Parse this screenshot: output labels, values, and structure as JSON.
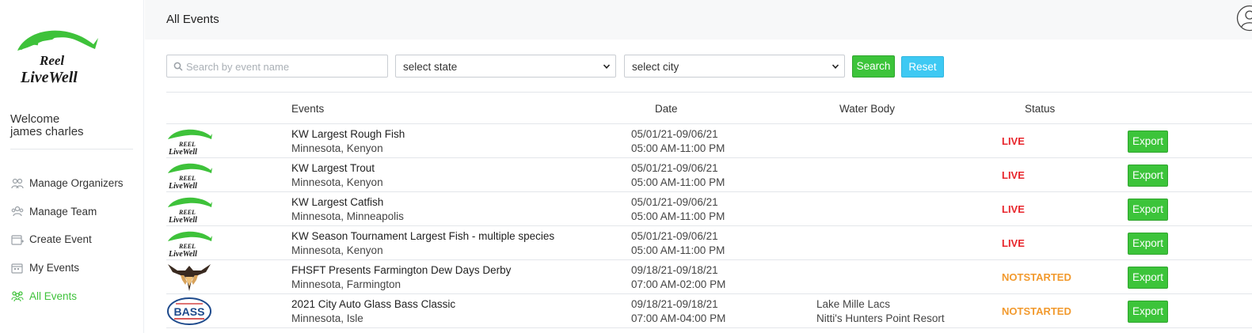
{
  "brand": {
    "logo_line1": "Reel",
    "logo_line2": "LiveWell",
    "color": "#3ec23a"
  },
  "sidebar": {
    "welcome": "Welcome",
    "username": "james charles",
    "items": [
      {
        "label": "Manage Organizers",
        "icon": "organizers-icon",
        "active": false
      },
      {
        "label": "Manage Team",
        "icon": "team-icon",
        "active": false
      },
      {
        "label": "Create Event",
        "icon": "calendar-add-icon",
        "active": false
      },
      {
        "label": "My Events",
        "icon": "calendar-icon",
        "active": false
      },
      {
        "label": "All Events",
        "icon": "group-icon",
        "active": true
      }
    ]
  },
  "header": {
    "title": "All Events",
    "user_icon": "user-avatar-icon"
  },
  "filters": {
    "search_placeholder": "Search by event name",
    "search_value": "",
    "state_select": "select state",
    "city_select": "select city",
    "search_label": "Search",
    "reset_label": "Reset"
  },
  "table": {
    "columns": {
      "events": "Events",
      "date": "Date",
      "water_body": "Water Body",
      "status": "Status"
    },
    "rows": [
      {
        "logo": "reel-livewell-logo",
        "name": "KW Largest Rough Fish",
        "location": "Minnesota, Kenyon",
        "date_range": "05/01/21-09/06/21",
        "time_range": "05:00 AM-11:00 PM",
        "water_body": "",
        "water_body_detail": "",
        "status": "LIVE",
        "export_label": "Export"
      },
      {
        "logo": "reel-livewell-logo",
        "name": "KW Largest Trout",
        "location": "Minnesota, Kenyon",
        "date_range": "05/01/21-09/06/21",
        "time_range": "05:00 AM-11:00 PM",
        "water_body": "",
        "water_body_detail": "",
        "status": "LIVE",
        "export_label": "Export"
      },
      {
        "logo": "reel-livewell-logo",
        "name": "KW Largest Catfish",
        "location": "Minnesota, Minneapolis",
        "date_range": "05/01/21-09/06/21",
        "time_range": "05:00 AM-11:00 PM",
        "water_body": "",
        "water_body_detail": "",
        "status": "LIVE",
        "export_label": "Export"
      },
      {
        "logo": "reel-livewell-logo",
        "name": "KW Season Tournament Largest Fish - multiple species",
        "location": "Minnesota, Kenyon",
        "date_range": "05/01/21-09/06/21",
        "time_range": "05:00 AM-11:00 PM",
        "water_body": "",
        "water_body_detail": "",
        "status": "LIVE",
        "export_label": "Export"
      },
      {
        "logo": "fhsft-antler-logo",
        "name": "FHSFT Presents Farmington Dew Days Derby",
        "location": "Minnesota, Farmington",
        "date_range": "09/18/21-09/18/21",
        "time_range": "07:00 AM-02:00 PM",
        "water_body": "",
        "water_body_detail": "",
        "status": "NOTSTARTED",
        "export_label": "Export"
      },
      {
        "logo": "bass-federation-logo",
        "name": "2021 City Auto Glass Bass Classic",
        "location": "Minnesota, Isle",
        "date_range": "09/18/21-09/18/21",
        "time_range": "07:00 AM-04:00 PM",
        "water_body": "Lake Mille Lacs",
        "water_body_detail": "Nitti's Hunters Point Resort",
        "status": "NOTSTARTED",
        "export_label": "Export",
        "logo_text": "BASS"
      }
    ]
  },
  "colors": {
    "live": "#e8262c",
    "notstarted": "#f29a2e",
    "green_button": "#3cc43a",
    "reset_button": "#3ec9f3"
  }
}
